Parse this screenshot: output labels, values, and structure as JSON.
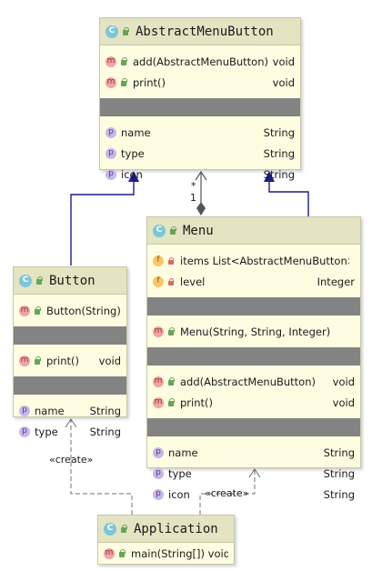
{
  "classes": {
    "abstract_menu_button": {
      "name": "AbstractMenuButton",
      "methods": [
        {
          "label": "add(AbstractMenuButton)",
          "type": "void"
        },
        {
          "label": "print()",
          "type": "void"
        }
      ],
      "fields": [
        {
          "label": "name",
          "type": "String"
        },
        {
          "label": "type",
          "type": "String"
        },
        {
          "label": "icon",
          "type": "String"
        }
      ]
    },
    "button": {
      "name": "Button",
      "constructors": [
        {
          "label": "Button(String)"
        }
      ],
      "methods": [
        {
          "label": "print()",
          "type": "void"
        }
      ],
      "fields": [
        {
          "label": "name",
          "type": "String"
        },
        {
          "label": "type",
          "type": "String"
        }
      ]
    },
    "menu": {
      "name": "Menu",
      "private_fields": [
        {
          "label": "items List<AbstractMenuButton>",
          "type": ""
        },
        {
          "label": "level",
          "type": "Integer"
        }
      ],
      "constructors": [
        {
          "label": "Menu(String, String, Integer)"
        }
      ],
      "methods": [
        {
          "label": "add(AbstractMenuButton)",
          "type": "void"
        },
        {
          "label": "print()",
          "type": "void"
        }
      ],
      "fields": [
        {
          "label": "name",
          "type": "String"
        },
        {
          "label": "type",
          "type": "String"
        },
        {
          "label": "icon",
          "type": "String"
        }
      ]
    },
    "application": {
      "name": "Application",
      "methods": [
        {
          "label": "main(String[]) void",
          "type": ""
        }
      ]
    }
  },
  "relations": {
    "multiplicity_star": "*",
    "multiplicity_one": "1",
    "create_label_left": "«create»",
    "create_label_right": "«create»"
  },
  "icons": {
    "class": "C",
    "method": "m",
    "property": "p",
    "field": "f"
  },
  "colors": {
    "header_bg": "#e4e3c2",
    "body_bg": "#fefde2",
    "separator_band": "#838383",
    "inheritance_line": "#1c1c8c",
    "dependency_line": "#707070"
  }
}
